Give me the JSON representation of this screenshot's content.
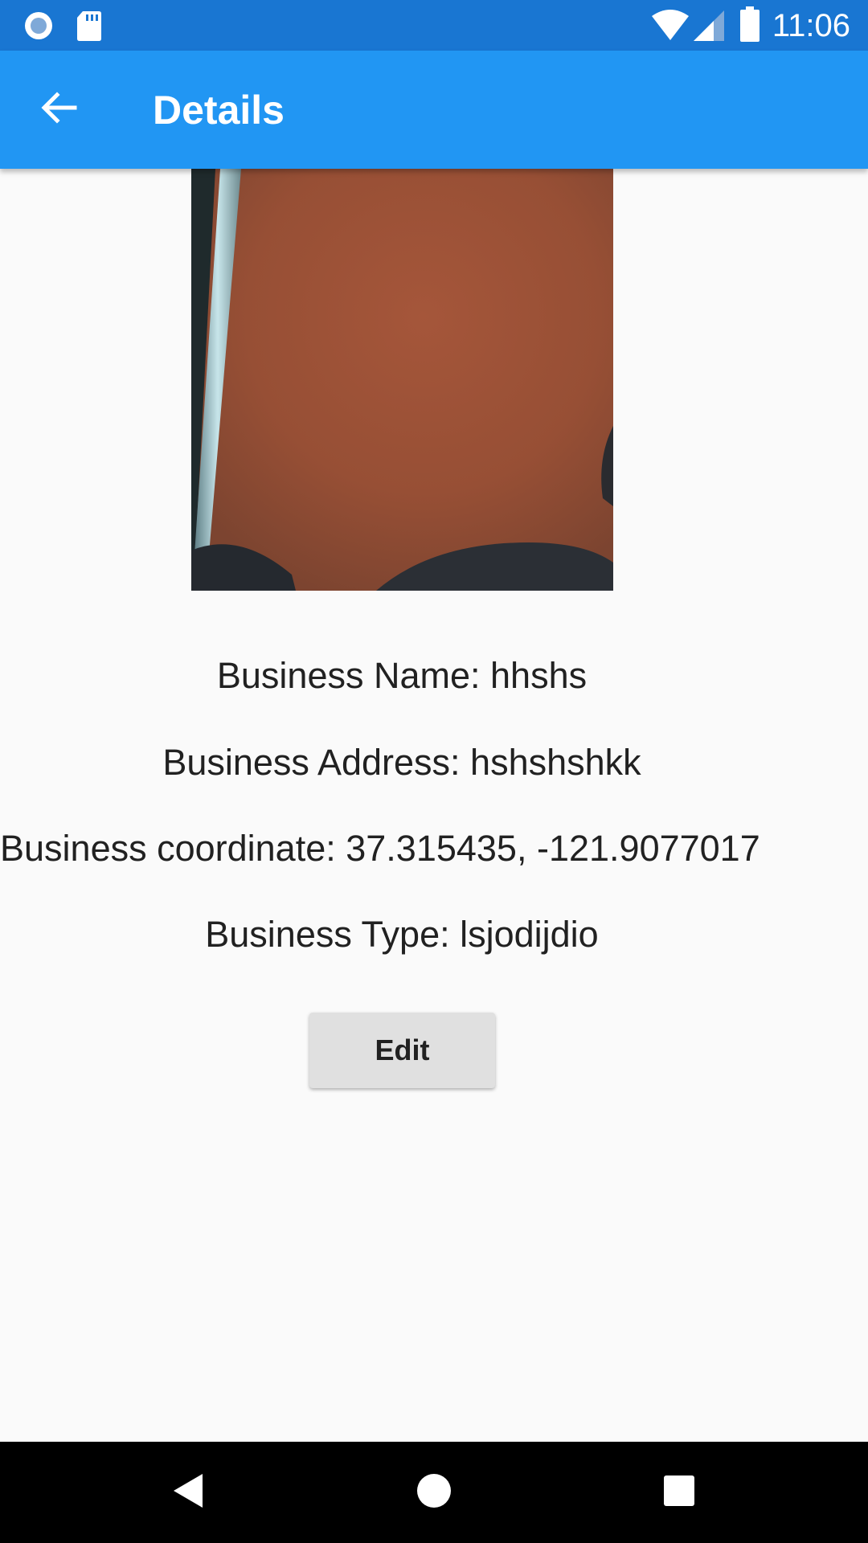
{
  "status_bar": {
    "time": "11:06",
    "left_icons": [
      "recording-icon",
      "sd-card-icon"
    ],
    "right_icons": [
      "wifi-icon",
      "cell-signal-icon",
      "battery-icon"
    ]
  },
  "app_bar": {
    "title": "Details",
    "back_icon": "arrow-back-icon",
    "color": "#2196f3"
  },
  "details": {
    "business_name": "Business Name: hhshs",
    "business_address": "Business Address: hshshshkk",
    "business_coordinate": "Business coordinate: 37.315435, -121.9077017",
    "business_type": "Business Type: lsjodijdio"
  },
  "edit_button": {
    "label": "Edit"
  },
  "nav_bar": {
    "icons": [
      "back-triangle-icon",
      "home-circle-icon",
      "recents-square-icon"
    ]
  }
}
